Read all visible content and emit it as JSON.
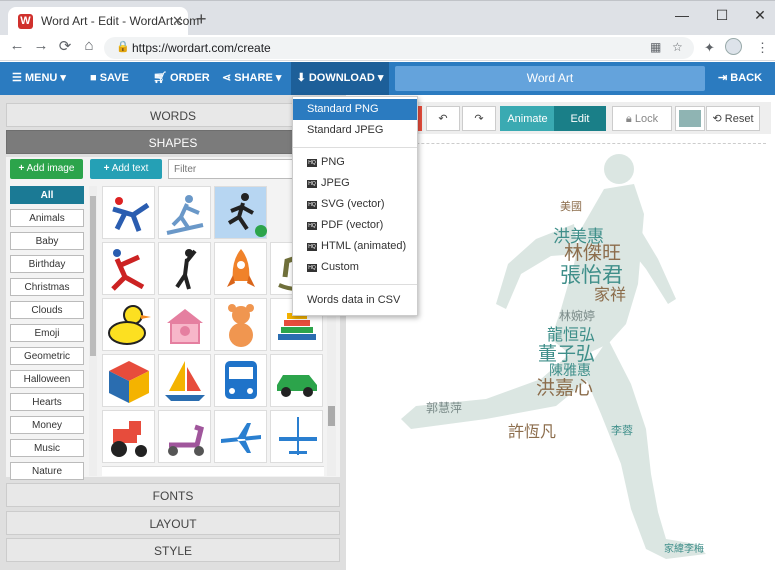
{
  "browser": {
    "tab_title": "Word Art - Edit - WordArt.com",
    "favicon_letter": "W",
    "url": "https://wordart.com/create"
  },
  "toolbar": {
    "menu": "MENU",
    "save": "SAVE",
    "order": "ORDER",
    "share": "SHARE",
    "download": "DOWNLOAD",
    "name": "Word Art",
    "back": "BACK"
  },
  "left": {
    "accordion": {
      "words": "WORDS",
      "shapes": "SHAPES",
      "fonts": "FONTS",
      "layout": "LAYOUT",
      "style": "STYLE"
    },
    "add_image": "Add image",
    "add_text": "Add text",
    "filter_placeholder": "Filter",
    "categories": [
      "All",
      "Animals",
      "Baby",
      "Birthday",
      "Christmas",
      "Clouds",
      "Emoji",
      "Geometric",
      "Halloween",
      "Hearts",
      "Money",
      "Music",
      "Nature"
    ],
    "selected_category": "All",
    "shapes": [
      "gymnast",
      "skier",
      "runner",
      "gymnast-2",
      "ballerina",
      "rocket",
      "rocking-horse",
      "duck",
      "piggy-bank",
      "teddy-bear",
      "ring-stack",
      "rubiks-cube",
      "sailboat",
      "bus",
      "car",
      "tractor",
      "scooter",
      "airplane",
      "airplane-2"
    ]
  },
  "editor": {
    "animate": "Animate",
    "edit": "Edit",
    "lock": "Lock",
    "reset": "Reset",
    "color": "#8fb4b3"
  },
  "download_menu": {
    "items": [
      "Standard PNG",
      "Standard JPEG",
      "PNG",
      "JPEG",
      "SVG (vector)",
      "PDF (vector)",
      "HTML (animated)",
      "Custom",
      "Words data in CSV"
    ],
    "highlighted": "Standard PNG",
    "hq_badge": "HQ"
  },
  "wordart": {
    "words": [
      "洪美惠",
      "林傑旺",
      "張怡君",
      "家祥",
      "林婉婷",
      "龍恒弘",
      "董子弘",
      "陳雅惠",
      "洪嘉心",
      "郭慧萍",
      "許恆凡",
      "家緯李梅",
      "美國",
      "李蓉"
    ],
    "colors": {
      "teal": "#3f8f8a",
      "brown": "#8c6d4c",
      "gray": "#7a8a88"
    }
  },
  "colors": {
    "brand": "#2b7bc0",
    "brand_dark": "#1d5f99",
    "green": "#2ca44b",
    "teal": "#1b7a95"
  }
}
